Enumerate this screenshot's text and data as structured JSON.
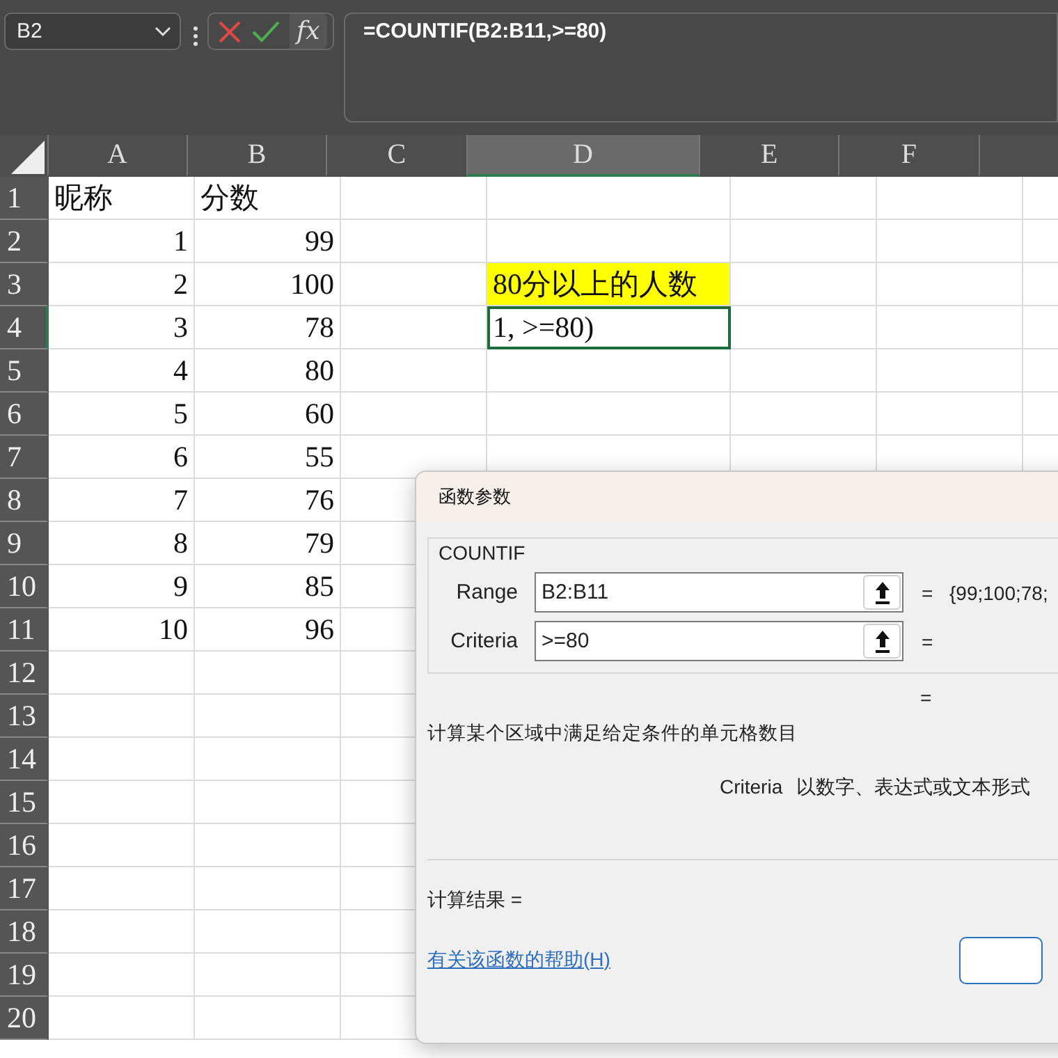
{
  "name_box": {
    "value": "B2"
  },
  "formula_buttons": {
    "fx": "fx"
  },
  "formula_bar": {
    "value": "=COUNTIF(B2:B11,>=80)"
  },
  "columns": [
    {
      "label": "A",
      "selected": false
    },
    {
      "label": "B",
      "selected": false
    },
    {
      "label": "C",
      "selected": false
    },
    {
      "label": "D",
      "selected": true
    },
    {
      "label": "E",
      "selected": false
    },
    {
      "label": "F",
      "selected": false
    }
  ],
  "rows": [
    {
      "label": "1",
      "selected": false,
      "cells": [
        {
          "kind": "text",
          "text": "昵称"
        },
        {
          "kind": "text",
          "text": "分数"
        }
      ]
    },
    {
      "label": "2",
      "selected": false,
      "cells": [
        {
          "kind": "number",
          "text": "1"
        },
        {
          "kind": "number",
          "text": "99"
        }
      ]
    },
    {
      "label": "3",
      "selected": false,
      "cells": [
        {
          "kind": "number",
          "text": "2"
        },
        {
          "kind": "number",
          "text": "100"
        },
        {
          "kind": "empty"
        },
        {
          "kind": "highlight",
          "text": "80分以上的人数"
        }
      ]
    },
    {
      "label": "4",
      "selected": true,
      "cells": [
        {
          "kind": "number",
          "text": "3"
        },
        {
          "kind": "number",
          "text": "78"
        },
        {
          "kind": "empty"
        },
        {
          "kind": "editing",
          "text": "1, >=80)"
        }
      ]
    },
    {
      "label": "5",
      "selected": false,
      "cells": [
        {
          "kind": "number",
          "text": "4"
        },
        {
          "kind": "number",
          "text": "80"
        }
      ]
    },
    {
      "label": "6",
      "selected": false,
      "cells": [
        {
          "kind": "number",
          "text": "5"
        },
        {
          "kind": "number",
          "text": "60"
        }
      ]
    },
    {
      "label": "7",
      "selected": false,
      "cells": [
        {
          "kind": "number",
          "text": "6"
        },
        {
          "kind": "number",
          "text": "55"
        }
      ]
    },
    {
      "label": "8",
      "selected": false,
      "cells": [
        {
          "kind": "number",
          "text": "7"
        },
        {
          "kind": "number",
          "text": "76"
        }
      ]
    },
    {
      "label": "9",
      "selected": false,
      "cells": [
        {
          "kind": "number",
          "text": "8"
        },
        {
          "kind": "number",
          "text": "79"
        }
      ]
    },
    {
      "label": "10",
      "selected": false,
      "cells": [
        {
          "kind": "number",
          "text": "9"
        },
        {
          "kind": "number",
          "text": "85"
        }
      ]
    },
    {
      "label": "11",
      "selected": false,
      "cells": [
        {
          "kind": "number",
          "text": "10"
        },
        {
          "kind": "number",
          "text": "96"
        }
      ]
    },
    {
      "label": "12",
      "selected": false,
      "cells": []
    },
    {
      "label": "13",
      "selected": false,
      "cells": []
    },
    {
      "label": "14",
      "selected": false,
      "cells": []
    },
    {
      "label": "15",
      "selected": false,
      "cells": []
    },
    {
      "label": "16",
      "selected": false,
      "cells": []
    },
    {
      "label": "17",
      "selected": false,
      "cells": []
    },
    {
      "label": "18",
      "selected": false,
      "cells": []
    },
    {
      "label": "19",
      "selected": false,
      "cells": []
    },
    {
      "label": "20",
      "selected": false,
      "cells": []
    }
  ],
  "dialog": {
    "title": "函数参数",
    "function_name": "COUNTIF",
    "arguments": [
      {
        "label": "Range",
        "value": "B2:B11",
        "sign": "=",
        "result": "{99;100;78;"
      },
      {
        "label": "Criteria",
        "value": ">=80",
        "sign": "="
      }
    ],
    "total_sign": "=",
    "description": "计算某个区域中满足给定条件的单元格数目",
    "argument_help": {
      "name": "Criteria",
      "text": "以数字、表达式或文本形式"
    },
    "result_label": "计算结果 =",
    "help_link": "有关该函数的帮助(H)"
  }
}
